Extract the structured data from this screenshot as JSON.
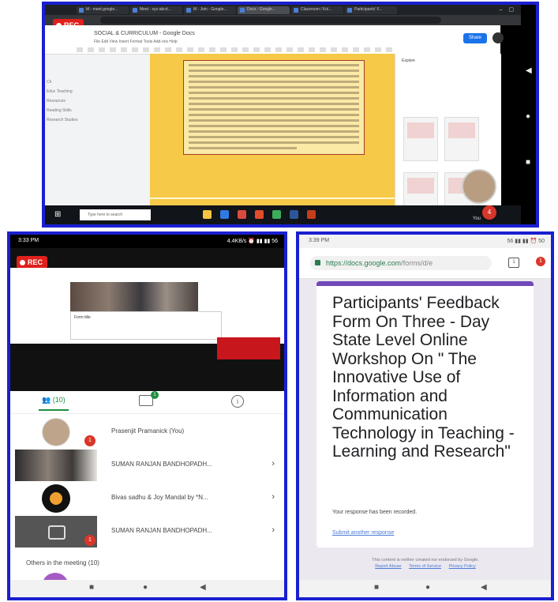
{
  "desktop": {
    "rec_label": "REC",
    "browser_tabs": [
      {
        "title": "M - meet.google..."
      },
      {
        "title": "Meet - xyz-abcd..."
      },
      {
        "title": "M - Join - Google..."
      },
      {
        "title": "Docs - Google..."
      },
      {
        "title": "Classroom / Kol..."
      },
      {
        "title": "Participants' F..."
      }
    ],
    "doc_title": "SOCIAL & CURRICULUM - Google Docs",
    "doc_menu": "File  Edit  View  Insert  Format  Tools  Add-ons  Help",
    "share_label": "Share",
    "outline_items": [
      "Ch",
      "Educ Teaching",
      "Resources",
      "Reading Skills",
      "Research Studies"
    ],
    "thumbs_header": "Explore",
    "taskbar_search": "Type here to search",
    "self_label": "You",
    "participant_count": "4",
    "colors": {
      "page": "#f7c948",
      "frame": "#1a1fd0",
      "rec": "#e0201c"
    }
  },
  "meet_phone": {
    "status_time": "3:33 PM",
    "status_right": "4.4KB/s  ⏰ ▮▮ ▮▮ 56",
    "rec_label": "REC",
    "shared_form_title": "Form title",
    "people_tab_label": "(10)",
    "chat_badge": "1",
    "info_label": "i",
    "participants": [
      {
        "name": "Prasenjit Pramanick (You)"
      },
      {
        "name": "SUMAN RANJAN BANDHOPADH..."
      },
      {
        "name": "Bivas sadhu & Joy Mandal by *N..."
      },
      {
        "name": "SUMAN RANJAN BANDHOPADH..."
      }
    ],
    "pin_badge": "1",
    "others_label": "Others in the meeting (10)",
    "chevron": "›",
    "nav": {
      "recents": "■",
      "home": "●",
      "back": "◀"
    }
  },
  "form_phone": {
    "status_time": "3:39 PM",
    "status_right": "56 ▮▮ ▮▮ ⏰ 50",
    "url_scheme": "https://",
    "url_host": "docs.google.com",
    "url_path": "/forms/d/e",
    "tabs_count": "1",
    "menu_badge": "1",
    "form_title": "Participants' Feedback Form On Three - Day State Level Online Workshop On \" The Innovative Use of Information and Communication Technology in Teaching - Learning and Research\"",
    "confirmation": "Your response has been recorded.",
    "submit_another": "Submit another response",
    "footer_text": "This content is neither created nor endorsed by Google.",
    "footer_links": [
      "Report Abuse",
      "Terms of Service",
      "Privacy Policy"
    ],
    "accent_color": "#7248b9",
    "nav": {
      "recents": "■",
      "home": "●",
      "back": "◀"
    }
  }
}
